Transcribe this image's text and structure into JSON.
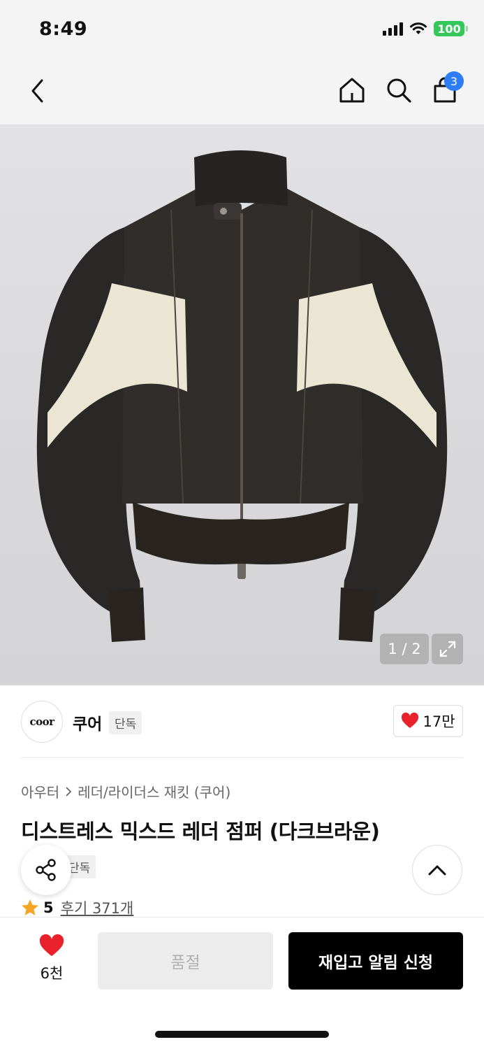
{
  "status_bar": {
    "time": "8:49",
    "battery": "100"
  },
  "nav": {
    "cart_count": "3"
  },
  "gallery": {
    "counter": "1 / 2"
  },
  "brand": {
    "logo_text": "coor",
    "name": "쿠어",
    "exclusive_badge": "단독",
    "likes": "17만"
  },
  "breadcrumb": {
    "category": "아우터",
    "subcategory": "레더/라이더스 재킷 (쿠어)"
  },
  "product": {
    "title": "디스트레스 믹스드 레더 점퍼 (다크브라운)",
    "tag": "단독",
    "rating": "5",
    "reviews": "후기 371개"
  },
  "bottom_bar": {
    "wish_count": "6천",
    "soldout_label": "품절",
    "restock_label": "재입고 알림 신청"
  },
  "colors": {
    "accent_blue": "#2e7cf6",
    "heart_red": "#e8212b",
    "battery_green": "#34c759",
    "star_orange": "#f5a623"
  },
  "icons": [
    "back-icon",
    "home-icon",
    "search-icon",
    "cart-icon",
    "expand-icon",
    "heart-icon",
    "share-icon",
    "chevron-up-icon",
    "star-icon"
  ]
}
